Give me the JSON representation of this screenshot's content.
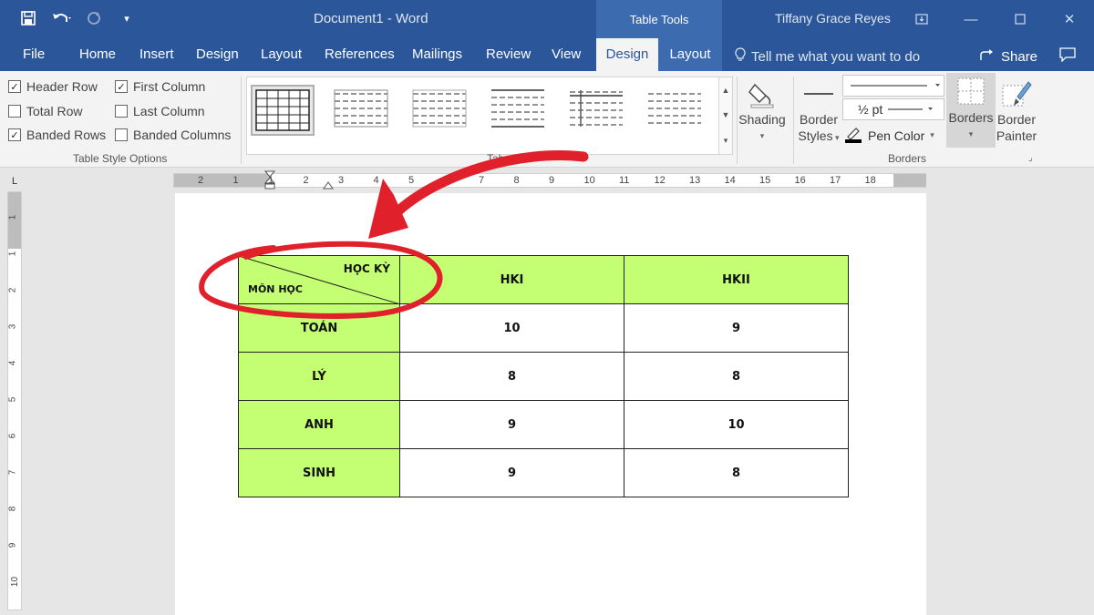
{
  "titlebar": {
    "document_title": "Document1  -  Word",
    "context_tab": "Table Tools",
    "user_name": "Tiffany Grace Reyes"
  },
  "tabs": {
    "file": "File",
    "home": "Home",
    "insert": "Insert",
    "design": "Design",
    "layout": "Layout",
    "references": "References",
    "mailings": "Mailings",
    "review": "Review",
    "view": "View",
    "table_design": "Design",
    "table_layout": "Layout",
    "tell_me": "Tell me what you want to do",
    "share": "Share"
  },
  "style_options": {
    "header_row": "Header Row",
    "first_column": "First Column",
    "total_row": "Total Row",
    "last_column": "Last Column",
    "banded_rows": "Banded Rows",
    "banded_columns": "Banded Columns",
    "group_label": "Table Style Options",
    "header_row_checked": true,
    "first_column_checked": true,
    "total_row_checked": false,
    "last_column_checked": false,
    "banded_rows_checked": true,
    "banded_columns_checked": false
  },
  "table_styles": {
    "group_label": "Tab"
  },
  "shading": {
    "label": "Shading"
  },
  "borders": {
    "border_styles_line1": "Border",
    "border_styles_line2": "Styles",
    "pen_weight": "½ pt",
    "pen_color": "Pen Color",
    "borders_label": "Borders",
    "border_painter_line1": "Border",
    "border_painter_line2": "Painter",
    "group_label": "Borders"
  },
  "ruler_h": [
    "2",
    "1",
    "1",
    "2",
    "3",
    "4",
    "5",
    "6",
    "7",
    "8",
    "9",
    "10",
    "11",
    "12",
    "13",
    "14",
    "15",
    "16",
    "17",
    "18"
  ],
  "ruler_v": [
    "1",
    "1",
    "2",
    "3",
    "4",
    "5",
    "6",
    "7",
    "8",
    "9",
    "10"
  ],
  "table": {
    "diag_top": "HỌC KỲ",
    "diag_bottom": "MÔN HỌC",
    "headers": [
      "HKI",
      "HKII"
    ],
    "rows": [
      {
        "subject": "TOÁN",
        "hk1": "10",
        "hk2": "9"
      },
      {
        "subject": "LÝ",
        "hk1": "8",
        "hk2": "8"
      },
      {
        "subject": "ANH",
        "hk1": "9",
        "hk2": "10"
      },
      {
        "subject": "SINH",
        "hk1": "9",
        "hk2": "8"
      }
    ]
  },
  "colors": {
    "title_blue": "#2b579a",
    "cell_green": "#c4ff73",
    "annotation_red": "#e0202a"
  }
}
